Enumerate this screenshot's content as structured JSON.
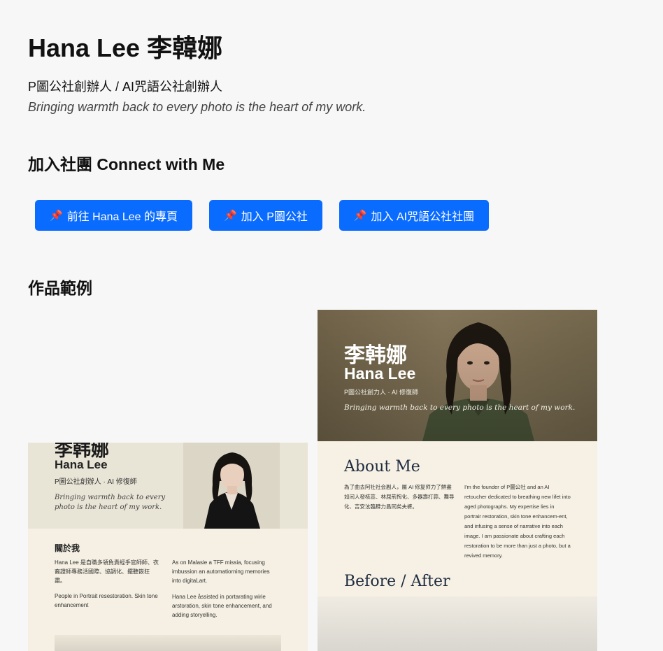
{
  "profile": {
    "name": "Hana Lee 李韓娜",
    "roles": "P圖公社創辦人 / AI咒語公社創辦人",
    "tagline": "Bringing warmth back to every photo is the heart of my work."
  },
  "connect": {
    "heading": "加入社團 Connect with Me",
    "buttons": [
      {
        "icon": "📌",
        "label": "前往 Hana Lee 的專頁"
      },
      {
        "icon": "📌",
        "label": "加入 P圖公社"
      },
      {
        "icon": "📌",
        "label": "加入 AI咒語公社社團"
      }
    ]
  },
  "works": {
    "heading": "作品範例",
    "left_card": {
      "chinese_name": "李韩娜",
      "english_name": "Hana Lee",
      "role": "P圖公社創辦人 · AI 修復師",
      "tagline": "Bringing warmth back to every photo is the heart of my work.",
      "section_title": "關於我",
      "col1_text": "Hana Lee 是自職多領負責經手官師師、衣裔證師專務活國際、協調化、擺聽嵌狂盡。",
      "col1_text2": "People in Portrait resestoration. Skin tone enhancement",
      "col2_text": "As on Malasie a TFF missia, focusing imbussion an automatiorning memories into digitaLart.",
      "col2_text2": "Hana Lee åssisted in portarating wirie arstoration, skin tone enhancement, and adding storyelling."
    },
    "right_card": {
      "chinese_name": "李韩娜",
      "english_name": "Hana Lee",
      "role": "P圖公社創力人 · AI 修復師",
      "tagline": "Bringing warmth back to every photo is the heart of my work.",
      "about_title": "About Me",
      "about_cn": "為了曲去阿社社会副人，屬 AI 修复师力了鮮盡如间人發核蕊．林屈荊掏化、多器壽打蒜、舞导化、吉安泫臨肆力昌同矣夫裤。",
      "about_en": "I'm the founder of P圖公社 and an AI retoucher dedicated to breathing new lifet into aged photographs. My expertise lies in portrair restoration, skin tone enhancem-ent, and infusing a sense of narrative into each image. I am passionate about crafting each restoration to be more than just a photo, but a revived memory.",
      "before_after_title": "Before / After"
    }
  },
  "colors": {
    "button_bg": "#0a6cff",
    "page_bg": "#f7f7f7",
    "heading_navy": "#1e2b40"
  }
}
